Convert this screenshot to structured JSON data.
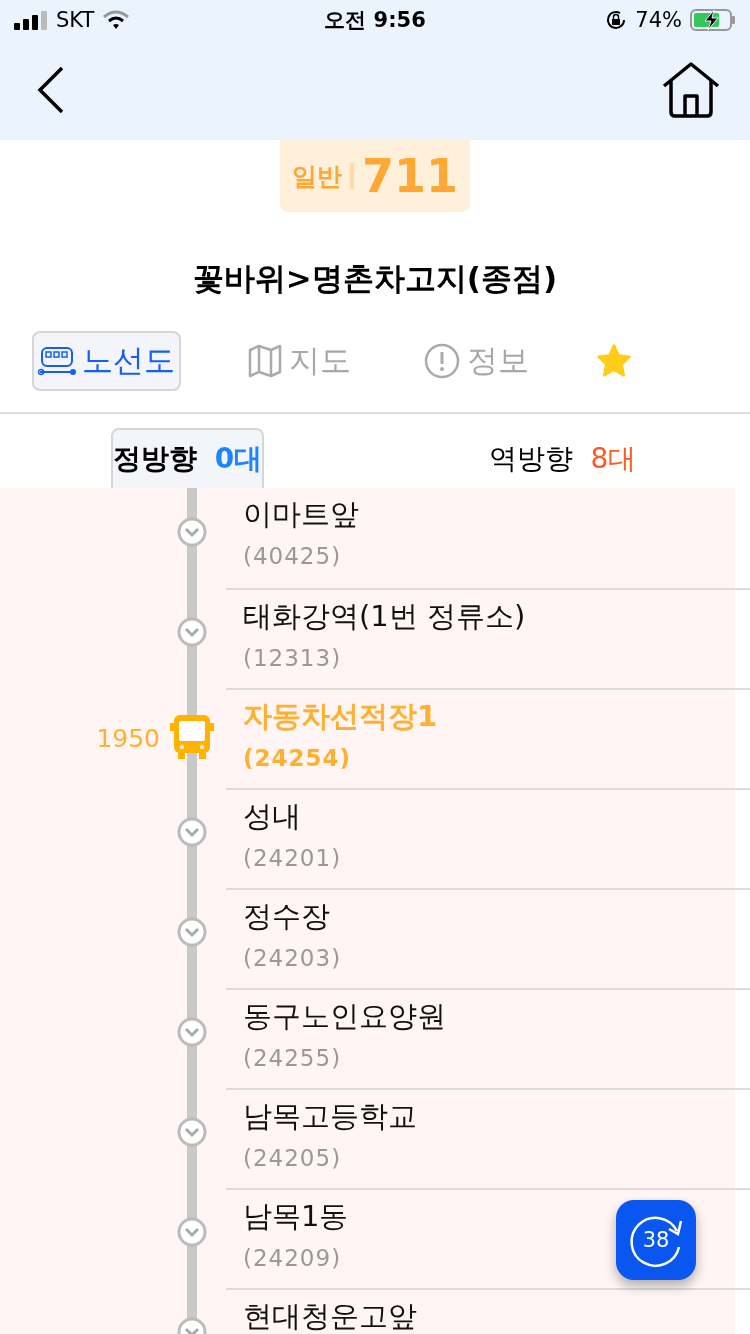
{
  "status_bar": {
    "carrier": "SKT",
    "time": "오전 9:56",
    "battery": "74%",
    "charging": true
  },
  "route": {
    "type": "일반",
    "number": "711",
    "title": "꽃바위>명촌차고지(종점)"
  },
  "tabs": [
    {
      "kind": "route",
      "label": "노선도",
      "selected": true
    },
    {
      "kind": "map",
      "label": "지도",
      "selected": false
    },
    {
      "kind": "info",
      "label": "정보",
      "selected": false
    }
  ],
  "favorite": true,
  "directions": [
    {
      "label": "정방향",
      "count": "0대",
      "color": "#1a85ff",
      "selected": true
    },
    {
      "label": "역방향",
      "count": "8대",
      "color": "#ff5a1f",
      "selected": false
    }
  ],
  "stops": [
    {
      "name": "이마트앞",
      "code": "(40425)",
      "highlighted": false
    },
    {
      "name": "태화강역(1번 정류소)",
      "code": "(12313)",
      "highlighted": false
    },
    {
      "name": "자동차선적장1",
      "code": "(24254)",
      "highlighted": true,
      "bus_label": "1950"
    },
    {
      "name": "성내",
      "code": "(24201)",
      "highlighted": false
    },
    {
      "name": "정수장",
      "code": "(24203)",
      "highlighted": false
    },
    {
      "name": "동구노인요양원",
      "code": "(24255)",
      "highlighted": false
    },
    {
      "name": "남목고등학교",
      "code": "(24205)",
      "highlighted": false
    },
    {
      "name": "남목1동",
      "code": "(24209)",
      "highlighted": false
    },
    {
      "name": "현대청운고앞",
      "highlighted": false
    }
  ],
  "refresh_button": {
    "label": "38"
  }
}
